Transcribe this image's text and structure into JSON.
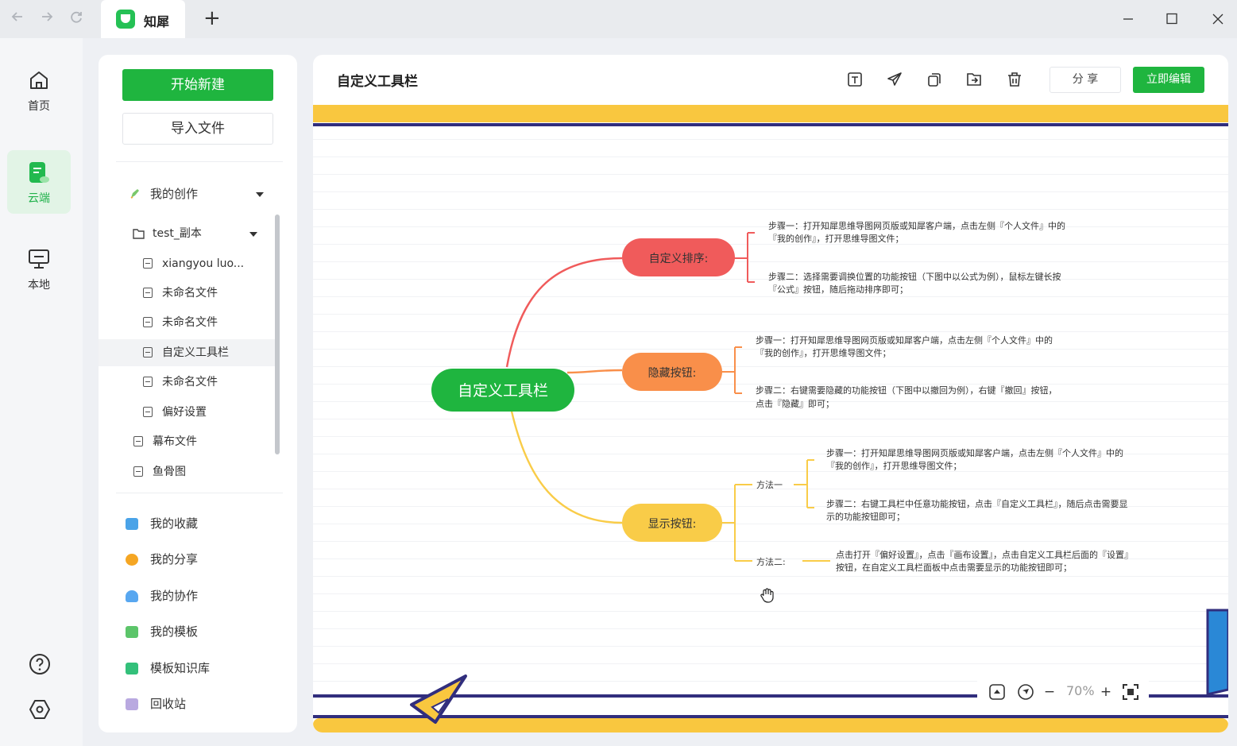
{
  "titlebar": {
    "back_icon": "arrow-left-icon",
    "forward_icon": "arrow-right-icon",
    "reload_icon": "reload-icon",
    "app_name": "知犀",
    "new_tab": "+"
  },
  "rail": {
    "items": [
      {
        "label": "首页",
        "icon": "home-icon"
      },
      {
        "label": "云端",
        "icon": "cloud-doc-icon"
      },
      {
        "label": "本地",
        "icon": "monitor-icon"
      }
    ],
    "help_icon": "help-icon",
    "settings_icon": "settings-hex-icon"
  },
  "sidebar": {
    "new_button": "开始新建",
    "import_button": "导入文件",
    "my_creation": "我的创作",
    "folder": "test_副本",
    "files": [
      {
        "label": "xiangyou luo..."
      },
      {
        "label": "未命名文件"
      },
      {
        "label": "未命名文件"
      },
      {
        "label": "自定义工具栏"
      },
      {
        "label": "未命名文件"
      },
      {
        "label": "偏好设置"
      }
    ],
    "root_files": [
      {
        "label": "幕布文件"
      },
      {
        "label": "鱼骨图"
      }
    ],
    "menu": [
      {
        "label": "我的收藏",
        "color": "#4aa3e8"
      },
      {
        "label": "我的分享",
        "color": "#f5a623"
      },
      {
        "label": "我的协作",
        "color": "#58a7f0"
      },
      {
        "label": "我的模板",
        "color": "#5cc56a"
      },
      {
        "label": "模板知识库",
        "color": "#33c07a"
      },
      {
        "label": "回收站",
        "color": "#b9a9e0"
      }
    ]
  },
  "main": {
    "title": "自定义工具栏",
    "toolbar_icons": [
      "text-box-icon",
      "send-icon",
      "copy-icon",
      "export-icon",
      "trash-icon"
    ],
    "share_button": "分 享",
    "edit_button": "立即编辑",
    "zoom": "70%",
    "zoom_minus": "−",
    "zoom_plus": "+"
  },
  "mindmap": {
    "root": "自定义工具栏",
    "branches": [
      {
        "label": "自定义排序:",
        "color": "#f05b5b",
        "leaves": [
          [
            "步骤一：打开知犀思维导图网页版或知犀客户端，点击左侧『个人文件』中的",
            "『我的创作』，打开思维导图文件；"
          ],
          [
            "步骤二：选择需要调换位置的功能按钮（下图中以公式为例），鼠标左键长按",
            "『公式』按钮，随后拖动排序即可；"
          ]
        ]
      },
      {
        "label": "隐藏按钮:",
        "color": "#f98f4a",
        "leaves": [
          [
            "步骤一：打开知犀思维导图网页版或知犀客户端，点击左侧『个人文件』中的",
            "『我的创作』，打开思维导图文件；"
          ],
          [
            "步骤二：右键需要隐藏的功能按钮（下图中以撤回为例），右键『撤回』按钮，",
            "点击『隐藏』即可；"
          ]
        ]
      },
      {
        "label": "显示按钮:",
        "color": "#f9cc48",
        "methods": [
          {
            "label": "方法一",
            "leaves": [
              [
                "步骤一：打开知犀思维导图网页版或知犀客户端，点击左侧『个人文件』中的",
                "『我的创作』，打开思维导图文件；"
              ],
              [
                "步骤二：右键工具栏中任意功能按钮，点击『自定义工具栏』，随后点击需要显",
                "示的功能按钮即可；"
              ]
            ]
          },
          {
            "label": "方法二:",
            "leaves": [
              [
                "点击打开『偏好设置』，点击『画布设置』，点击自定义工具栏后面的『设置』",
                "按钮，在自定义工具栏面板中点击需要显示的功能按钮即可；"
              ]
            ]
          }
        ]
      }
    ]
  }
}
